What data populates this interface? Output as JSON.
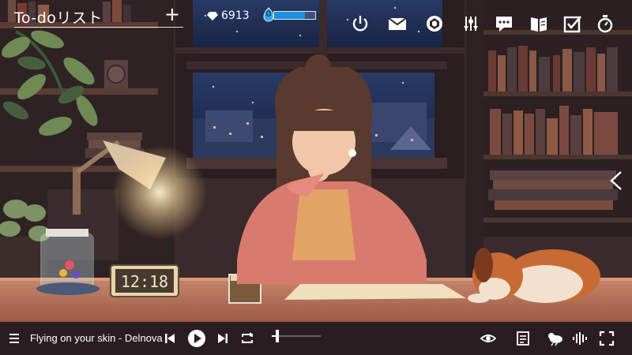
{
  "todo": {
    "title": "To-doリスト",
    "add_label": "+"
  },
  "stats": {
    "gems": "6913",
    "level": "0",
    "xp_fraction": 0.75
  },
  "desk": {
    "clock_time": "12:18"
  },
  "player": {
    "track": "Flying on your skin - Delnova",
    "progress_fraction": 0.12
  },
  "colors": {
    "accent": "#1f8fe0",
    "bar_bg": "#2a1d21",
    "night_sky": "#1b2747",
    "lamp_glow": "#ffe7b0"
  },
  "icons": {
    "top": [
      "power-icon",
      "mail-icon",
      "aperture-icon",
      "tuning-icon",
      "chat-icon",
      "book-icon",
      "checkbox-icon",
      "timer-icon"
    ],
    "bottom_left": [
      "menu-icon",
      "prev-icon",
      "play-icon",
      "next-icon",
      "repeat-icon"
    ],
    "bottom_right": [
      "eye-icon",
      "notes-icon",
      "weather-icon",
      "sound-wave-icon",
      "fullscreen-icon"
    ]
  }
}
